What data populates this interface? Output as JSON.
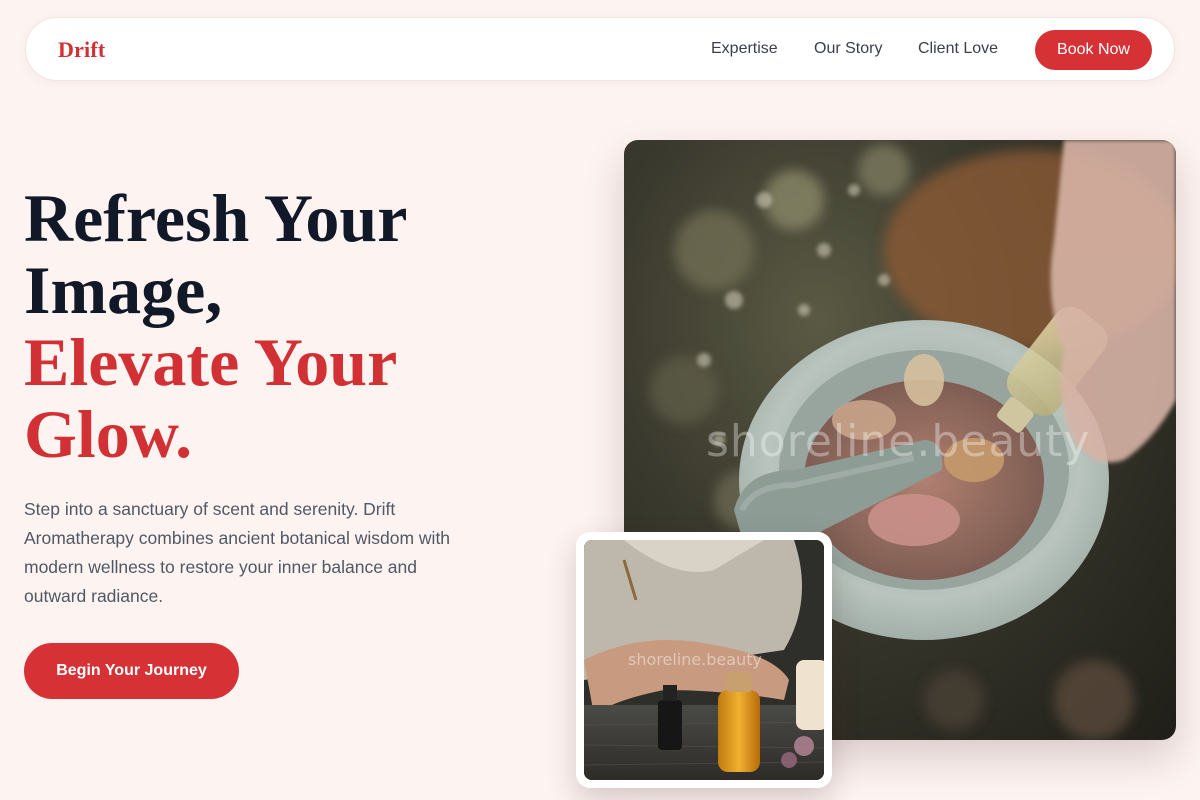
{
  "nav": {
    "brand": "Drift",
    "links": [
      "Expertise",
      "Our Story",
      "Client Love"
    ],
    "cta": "Book Now"
  },
  "hero": {
    "headline_dark": [
      "Refresh Your",
      "Image,"
    ],
    "headline_red": [
      "Elevate Your",
      "Glow."
    ],
    "description": "Step into a sanctuary of scent and serenity. Drift Aromatherapy combines ancient botanical wisdom with modern wellness to restore your inner balance and outward radiance.",
    "cta": "Begin Your Journey"
  },
  "images": {
    "main": {
      "watermark": "shoreline.beauty",
      "subject": "mortar and pestle with botanicals and oil bottle"
    },
    "secondary": {
      "watermark": "shoreline.beauty",
      "subject": "essential oil bottles and candle on wooden table"
    }
  },
  "colors": {
    "accent": "#d63236",
    "background": "#fdf3f1",
    "heading": "#111827",
    "body_text": "#505866"
  }
}
